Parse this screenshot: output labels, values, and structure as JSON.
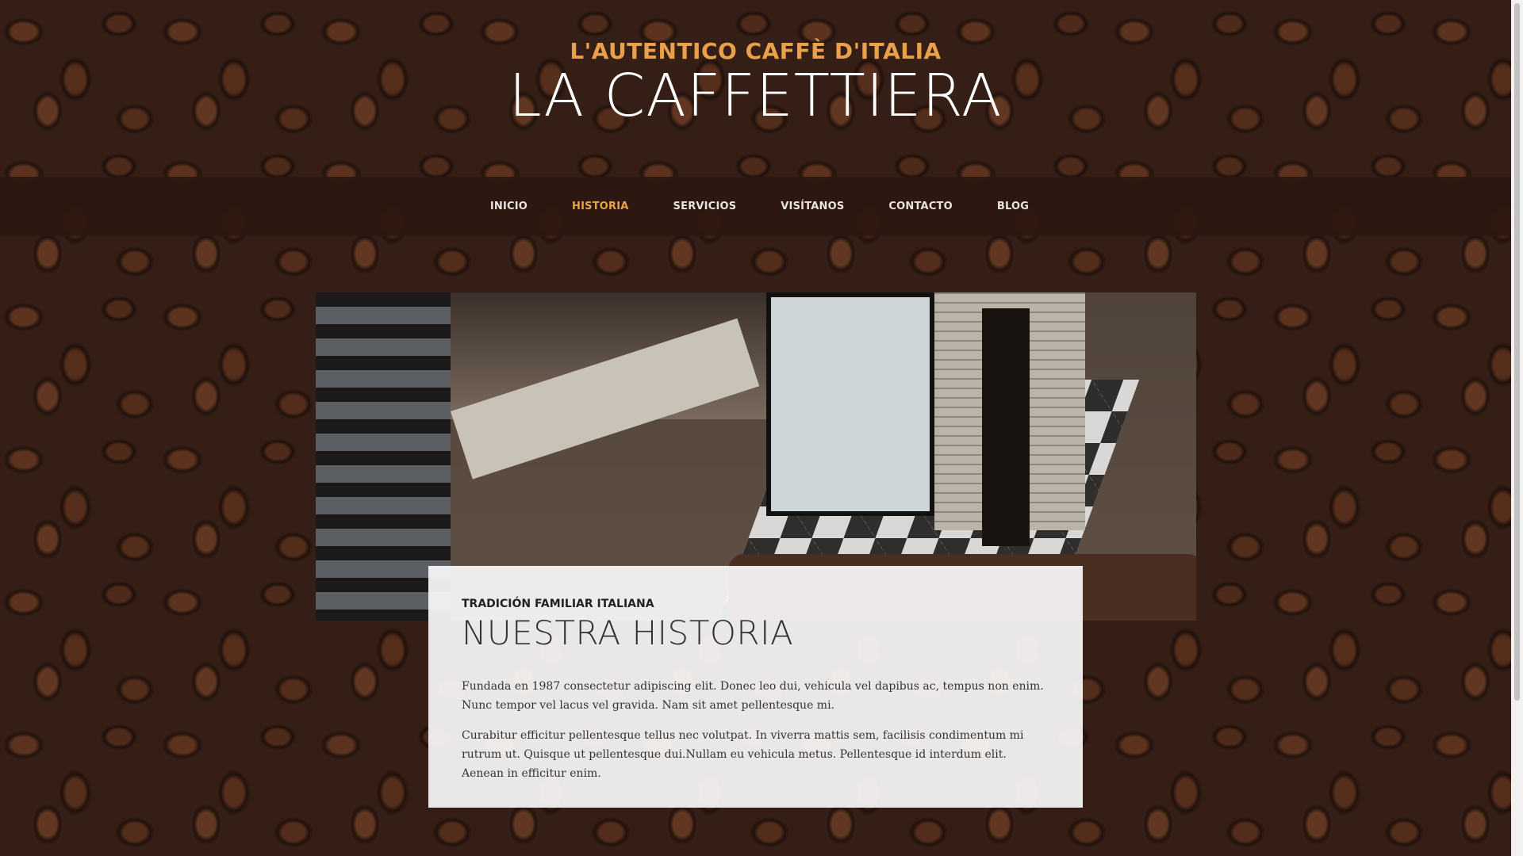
{
  "header": {
    "tagline": "L'AUTENTICO CAFFÈ D'ITALIA",
    "title": "LA CAFFETTIERA"
  },
  "nav": {
    "items": [
      {
        "label": "INICIO",
        "active": false
      },
      {
        "label": "HISTORIA",
        "active": true
      },
      {
        "label": "SERVICIOS",
        "active": false
      },
      {
        "label": "VISÍTANOS",
        "active": false
      },
      {
        "label": "CONTACTO",
        "active": false
      },
      {
        "label": "BLOG",
        "active": false
      }
    ]
  },
  "content": {
    "kicker": "TRADICIÓN FAMILIAR ITALIANA",
    "title": "NUESTRA HISTORIA",
    "paragraphs": [
      "Fundada en 1987 consectetur adipiscing elit. Donec leo dui, vehicula vel dapibus ac, tempus non enim. Nunc tempor vel lacus vel gravida. Nam sit amet pellentesque mi.",
      "Curabitur efficitur pellentesque tellus nec volutpat. In viverra mattis sem, facilisis condimentum mi rutrum ut. Quisque ut pellentesque dui.Nullam eu vehicula metus. Pellentesque id interdum elit. Aenean in efficitur enim."
    ]
  },
  "colors": {
    "accent": "#e9a04a",
    "nav_background": "#2b1810",
    "card_background": "#fafafa"
  }
}
